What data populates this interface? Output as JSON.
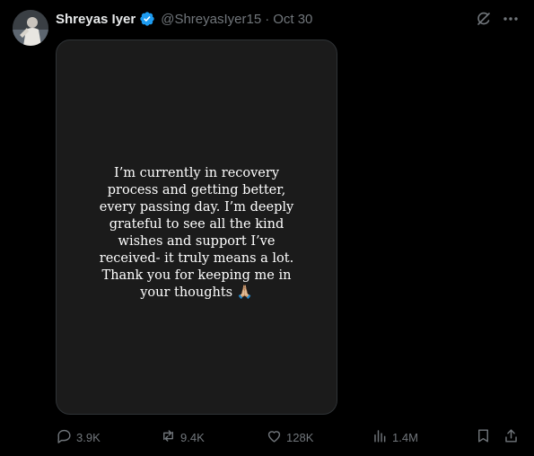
{
  "post": {
    "author_name": "Shreyas Iyer",
    "handle": "@ShreyasIyer15",
    "separator": "·",
    "timestamp": "Oct 30",
    "media_text": "I’m currently in recovery process and getting better, every passing day. I’m deeply grateful to see all the kind wishes and support I’ve received- it truly means a lot. Thank you for keeping me in your thoughts 🙏🏼"
  },
  "actions": {
    "replies": "3.9K",
    "reposts": "9.4K",
    "likes": "128K",
    "views": "1.4M"
  },
  "colors": {
    "background": "#000000",
    "text": "#e7e9ea",
    "muted": "#71767b",
    "verified": "#1d9bf0",
    "media_bg": "#1b1b1b"
  },
  "icons": [
    "verified-badge-icon",
    "grok-icon",
    "more-icon",
    "reply-icon",
    "repost-icon",
    "like-icon",
    "views-icon",
    "bookmark-icon",
    "share-icon"
  ]
}
